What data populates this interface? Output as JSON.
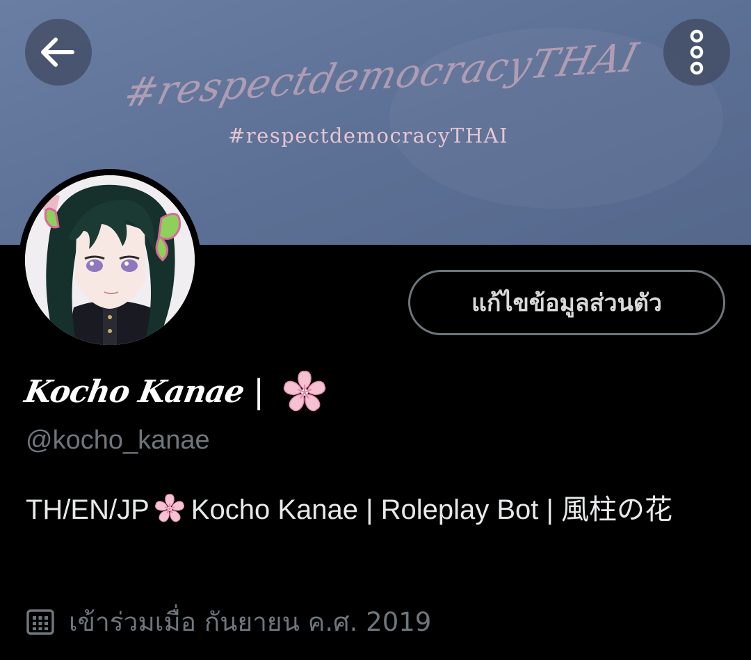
{
  "banner": {
    "script_text": "#respectdemocracyTHAI",
    "text": "#respectdemocracyTHAI"
  },
  "topbar": {
    "back_icon": "arrow-left-icon",
    "more_icon": "more-vertical-icon"
  },
  "profile": {
    "avatar_icon": "avatar-anime-character",
    "edit_button_label": "แก้ไขข้อมูลส่วนตัว",
    "display_name": "Kocho Kanae",
    "display_name_separator": "|",
    "display_name_emoji": "cherry-blossom-icon",
    "handle": "@kocho_kanae",
    "bio_part1": "TH/EN/JP",
    "bio_emoji": "cherry-blossom-icon",
    "bio_part2": "Kocho Kanae | Roleplay  Bot |  風柱の花",
    "joined_icon": "calendar-icon",
    "joined_text": "เข้าร่วมเมื่อ กันยายน ค.ศ. 2019"
  },
  "colors": {
    "background": "#000000",
    "banner": "#5f7297",
    "muted_text": "#6e767d",
    "primary_text": "#e7e9ea",
    "button_border": "#6e767d",
    "blossom": "#f4b6cb"
  }
}
